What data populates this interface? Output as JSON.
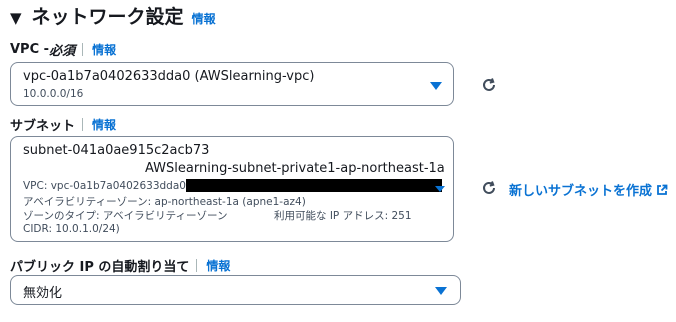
{
  "section": {
    "title": "ネットワーク設定",
    "info": "情報"
  },
  "vpc": {
    "label": "VPC - ",
    "required": "必須",
    "info": "情報",
    "selected": "vpc-0a1b7a0402633dda0 (AWSlearning-vpc)",
    "cidr": "10.0.0.0/16"
  },
  "subnet": {
    "label": "サブネット",
    "info": "情報",
    "id": "subnet-041a0ae915c2acb73",
    "name": "AWSlearning-subnet-private1-ap-northeast-1a",
    "vpc_line": "VPC: vpc-0a1b7a0402633dda0",
    "az_line": "アベイラビリティーゾーン: ap-northeast-1a (apne1-az4)",
    "zone_type_line": "ゾーンのタイプ: アベイラビリティーゾーン",
    "available_ip_line": "利用可能な IP アドレス: 251",
    "cidr_line": "CIDR: 10.0.1.0/24)",
    "create_link": "新しいサブネットを作成"
  },
  "public_ip": {
    "label": "パブリック IP の自動割り当て",
    "info": "情報",
    "selected": "無効化"
  },
  "colors": {
    "link": "#0972d3",
    "border": "#7d8998",
    "text": "#16191f"
  },
  "icons": [
    "caret-down-icon",
    "dropdown-triangle-icon",
    "refresh-icon",
    "external-link-icon"
  ]
}
